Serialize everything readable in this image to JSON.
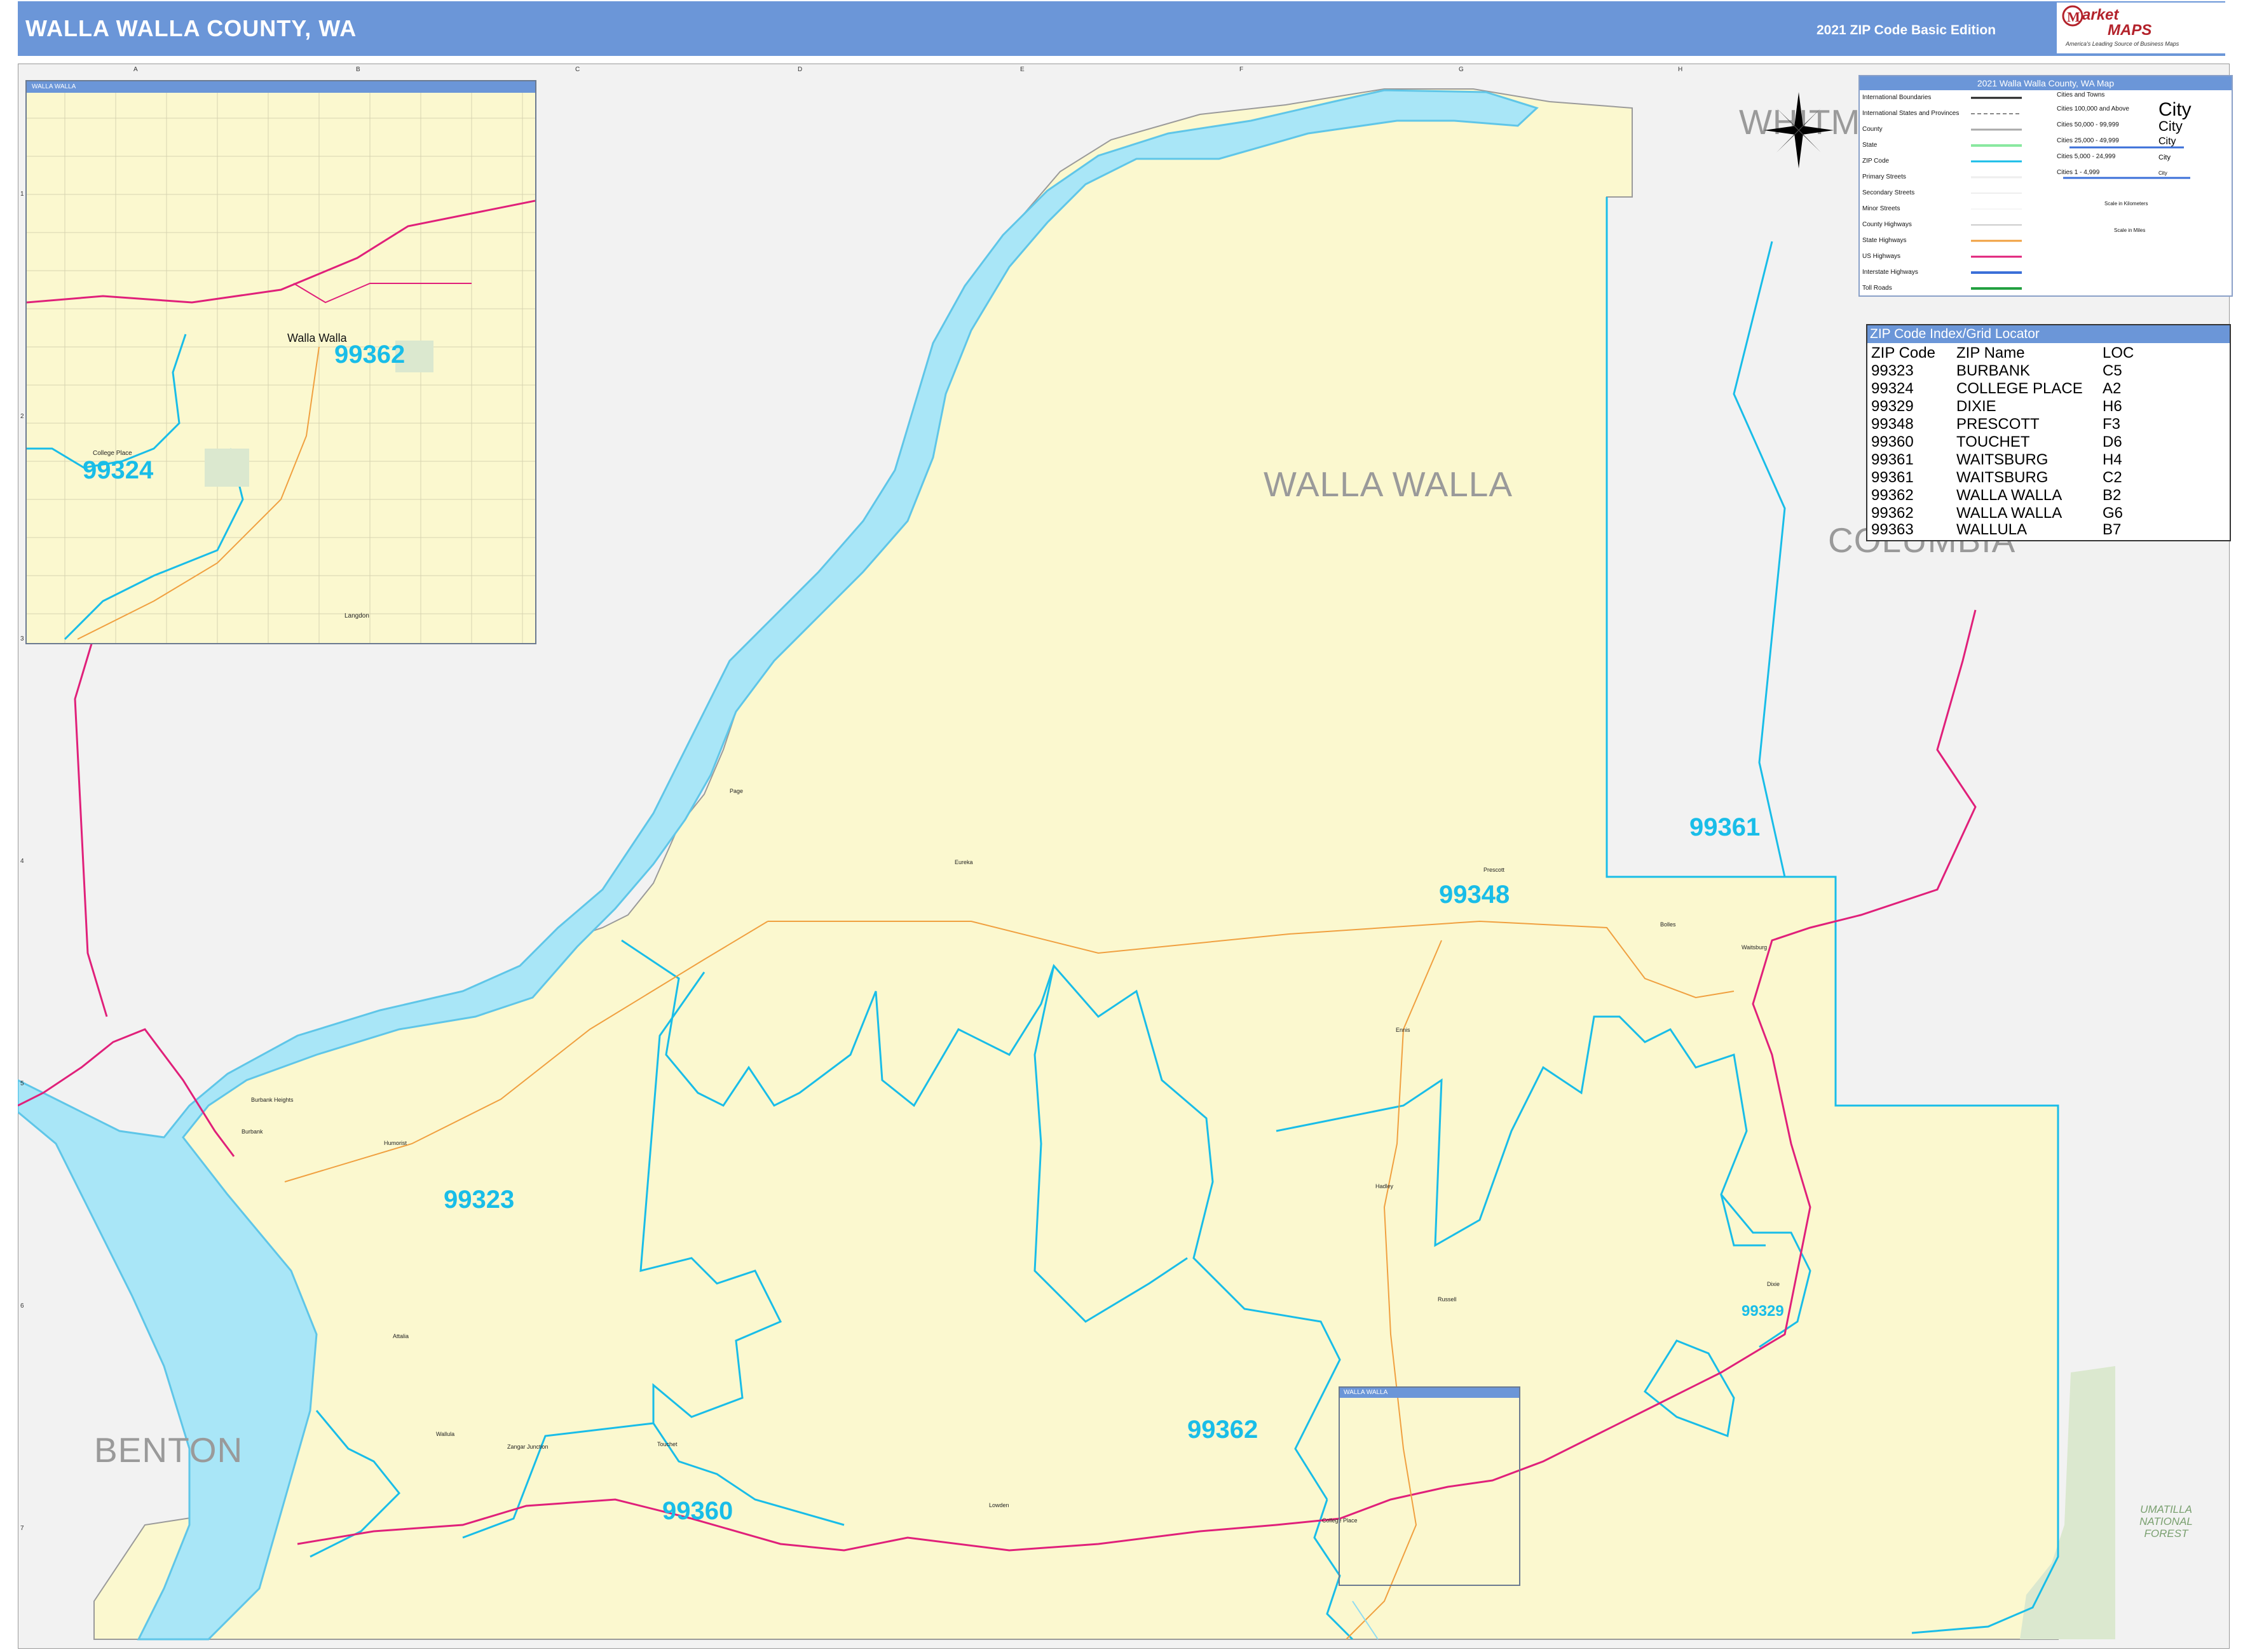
{
  "header": {
    "title": "WALLA WALLA COUNTY, WA",
    "edition": "2021 ZIP Code Basic Edition",
    "logo_top": "arket",
    "logo_bottom": "MAPS",
    "logo_tagline": "America's Leading Source of Business Maps",
    "brand_color": "#6b96d8"
  },
  "grid": {
    "columns": [
      "A",
      "B",
      "C",
      "D",
      "E",
      "F",
      "G",
      "H"
    ],
    "rows": [
      "1",
      "2",
      "3",
      "4",
      "5",
      "6",
      "7"
    ]
  },
  "counties": {
    "walla_walla": "WALLA WALLA",
    "columbia": "COLUMBIA",
    "whitman": "WHITMAN",
    "benton": "BENTON",
    "forest": "UMATILLA NATIONAL FOREST"
  },
  "zip_labels": {
    "z99361": "99361",
    "z99348": "99348",
    "z99323": "99323",
    "z99362": "99362",
    "z99360": "99360",
    "z99329": "99329",
    "z99362_inset": "99362",
    "z99324_inset": "99324"
  },
  "inset": {
    "title": "WALLA WALLA",
    "city": "Walla Walla",
    "college_place": "College Place",
    "langdon": "Langdon"
  },
  "mini_inset_title": "WALLA WALLA",
  "places": {
    "burbank": "Burbank",
    "burbank_heights": "Burbank Heights",
    "humorist": "Humorist",
    "wallula": "Wallula",
    "attalia": "Attalia",
    "touchet": "Touchet",
    "lowden": "Lowden",
    "prescott": "Prescott",
    "waitsburg": "Waitsburg",
    "dixie": "Dixie",
    "russell": "Russell",
    "eureka": "Eureka",
    "page": "Page",
    "bolles": "Bolles",
    "hadley": "Hadley",
    "ennis": "Ennis",
    "zangar_junction": "Zangar Junction",
    "college_place": "College Place"
  },
  "legend": {
    "title": "2021 Walla Walla County, WA Map",
    "left_items": [
      "International Boundaries",
      "International States and Provinces",
      "County",
      "State",
      "ZIP Code",
      "Primary Streets",
      "Secondary Streets",
      "Minor Streets",
      "County Highways",
      "State Highways",
      "US Highways",
      "Interstate Highways",
      "Toll Roads"
    ],
    "right_header": "Cities and Towns",
    "right_items": [
      "Cities 100,000 and Above",
      "Cities 50,000 - 99,999",
      "Cities 25,000 - 49,999",
      "Cities 5,000 - 24,999",
      "Cities 1 - 4,999"
    ],
    "city_samples": [
      "City",
      "City",
      "City",
      "City",
      "City"
    ],
    "scale_km": "Scale in Kilometers",
    "scale_mi": "Scale in Miles"
  },
  "zip_index": {
    "title": "ZIP Code Index/Grid Locator",
    "headers": [
      "ZIP Code",
      "ZIP Name",
      "LOC"
    ],
    "rows": [
      [
        "99323",
        "BURBANK",
        "C5"
      ],
      [
        "99324",
        "COLLEGE PLACE",
        "A2"
      ],
      [
        "99329",
        "DIXIE",
        "H6"
      ],
      [
        "99348",
        "PRESCOTT",
        "F3"
      ],
      [
        "99360",
        "TOUCHET",
        "D6"
      ],
      [
        "99361",
        "WAITSBURG",
        "H4"
      ],
      [
        "99361",
        "WAITSBURG",
        "C2"
      ],
      [
        "99362",
        "WALLA WALLA",
        "B2"
      ],
      [
        "99362",
        "WALLA WALLA",
        "G6"
      ],
      [
        "99363",
        "WALLULA",
        "B7"
      ]
    ]
  }
}
